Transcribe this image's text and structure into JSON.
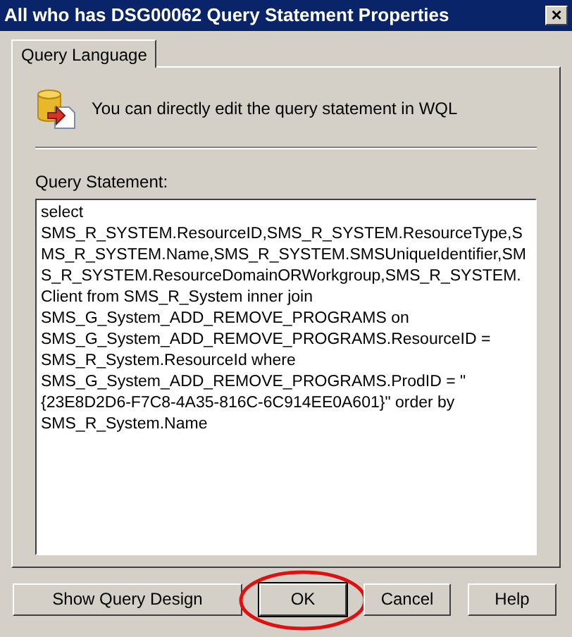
{
  "window": {
    "title": "All who has DSG00062 Query Statement Properties",
    "close": "×"
  },
  "tabs": [
    {
      "label": "Query Language",
      "selected": true
    }
  ],
  "info": "You can directly edit the query statement in WQL",
  "query": {
    "label": "Query Statement:",
    "value": "select SMS_R_SYSTEM.ResourceID,SMS_R_SYSTEM.ResourceType,SMS_R_SYSTEM.Name,SMS_R_SYSTEM.SMSUniqueIdentifier,SMS_R_SYSTEM.ResourceDomainORWorkgroup,SMS_R_SYSTEM.Client from SMS_R_System inner join SMS_G_System_ADD_REMOVE_PROGRAMS on SMS_G_System_ADD_REMOVE_PROGRAMS.ResourceID = SMS_R_System.ResourceId where SMS_G_System_ADD_REMOVE_PROGRAMS.ProdID = \"{23E8D2D6-F7C8-4A35-816C-6C914EE0A601}\" order by SMS_R_System.Name"
  },
  "buttons": [
    {
      "label": "Show Query Design",
      "default": false,
      "circled": false
    },
    {
      "label": "OK",
      "default": true,
      "circled": true
    },
    {
      "label": "Cancel",
      "default": false,
      "circled": false
    },
    {
      "label": "Help",
      "default": false,
      "circled": false
    }
  ]
}
